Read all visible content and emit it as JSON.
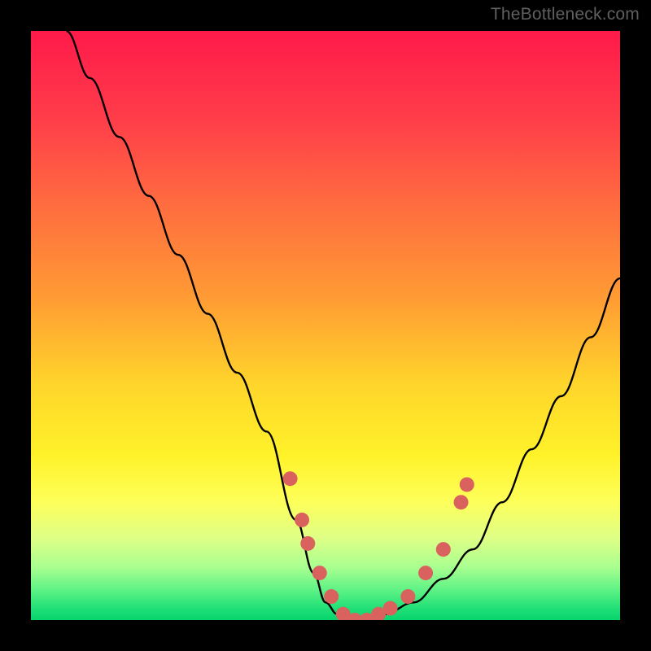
{
  "watermark": "TheBottleneck.com",
  "chart_data": {
    "type": "line",
    "title": "",
    "xlabel": "",
    "ylabel": "",
    "xlim": [
      0,
      100
    ],
    "ylim": [
      0,
      100
    ],
    "series": [
      {
        "name": "bottleneck-curve",
        "x": [
          6,
          10,
          15,
          20,
          25,
          30,
          35,
          40,
          45,
          48,
          50,
          52,
          55,
          58,
          60,
          65,
          70,
          75,
          80,
          85,
          90,
          95,
          100
        ],
        "values": [
          100,
          92,
          82,
          72,
          62,
          52,
          42,
          32,
          17,
          8,
          3,
          1,
          0,
          0,
          1,
          3,
          7,
          12,
          20,
          29,
          38,
          48,
          58
        ]
      }
    ],
    "markers": {
      "name": "highlighted-points",
      "color": "#d9625f",
      "points": [
        {
          "x": 44,
          "y": 24
        },
        {
          "x": 46,
          "y": 17
        },
        {
          "x": 47,
          "y": 13
        },
        {
          "x": 49,
          "y": 8
        },
        {
          "x": 51,
          "y": 4
        },
        {
          "x": 53,
          "y": 1
        },
        {
          "x": 55,
          "y": 0
        },
        {
          "x": 57,
          "y": 0
        },
        {
          "x": 59,
          "y": 1
        },
        {
          "x": 61,
          "y": 2
        },
        {
          "x": 64,
          "y": 4
        },
        {
          "x": 67,
          "y": 8
        },
        {
          "x": 70,
          "y": 12
        },
        {
          "x": 73,
          "y": 20
        },
        {
          "x": 74,
          "y": 23
        }
      ]
    },
    "gradient_stops": [
      {
        "pos": 0.0,
        "color": "#ff1a4a"
      },
      {
        "pos": 0.15,
        "color": "#ff3d4a"
      },
      {
        "pos": 0.3,
        "color": "#ff6e3f"
      },
      {
        "pos": 0.45,
        "color": "#ff9a34"
      },
      {
        "pos": 0.6,
        "color": "#ffd52b"
      },
      {
        "pos": 0.72,
        "color": "#fff229"
      },
      {
        "pos": 0.8,
        "color": "#fdff5a"
      },
      {
        "pos": 0.86,
        "color": "#dfff86"
      },
      {
        "pos": 0.91,
        "color": "#a9ff90"
      },
      {
        "pos": 0.95,
        "color": "#5cf285"
      },
      {
        "pos": 0.98,
        "color": "#21e077"
      },
      {
        "pos": 1.0,
        "color": "#06d46c"
      }
    ]
  }
}
